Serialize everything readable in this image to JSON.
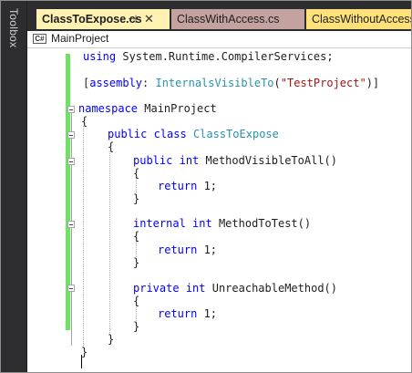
{
  "toolbox": {
    "label": "Toolbox"
  },
  "tabs": [
    {
      "label": "ClassToExpose.cs",
      "pin": "⊣",
      "close": "✕",
      "active": true
    },
    {
      "label": "ClassWithAccess.cs"
    },
    {
      "label": "ClassWithoutAccess.cs"
    }
  ],
  "navbar": {
    "icon": "C#",
    "project": "MainProject"
  },
  "colors": {
    "active_tab": "#fff2b3",
    "tab2": "#c4a2a0",
    "tab3": "#ffe17a",
    "change_bar": "#6fe164",
    "keyword": "#0000ff",
    "type": "#2b91af",
    "string": "#a31515"
  },
  "code": {
    "l1_kw": "using",
    "l1_rest": " System.Runtime.CompilerServices;",
    "l2_open": "[",
    "l2_kw": "assembly",
    "l2_colon": ": ",
    "l2_type": "InternalsVisibleTo",
    "l2_paren": "(",
    "l2_str": "\"TestProject\"",
    "l2_close": ")]",
    "l3_kw": "namespace",
    "l3_rest": " MainProject",
    "brace_open": "{",
    "brace_close": "}",
    "l5_kw1": "public",
    "l5_kw2": "class",
    "l5_type": "ClassToExpose",
    "m1_kw1": "public",
    "m1_kw2": "int",
    "m1_name": " MethodVisibleToAll()",
    "m2_kw1": "internal",
    "m2_kw2": "int",
    "m2_name": " MethodToTest()",
    "m3_kw1": "private",
    "m3_kw2": "int",
    "m3_name": " UnreachableMethod()",
    "ret_kw": "return",
    "ret_rest": " 1;"
  }
}
